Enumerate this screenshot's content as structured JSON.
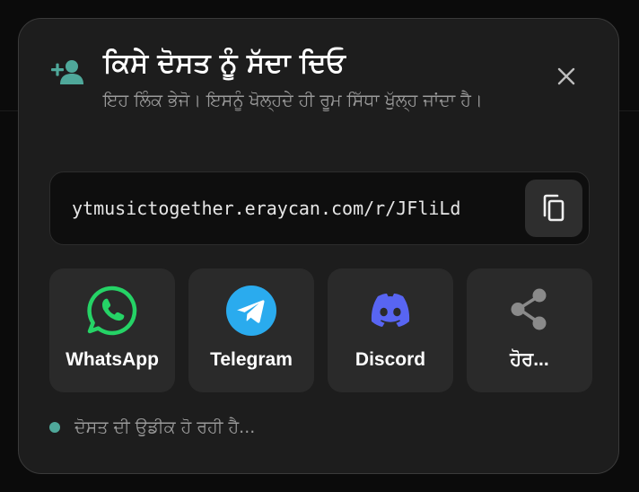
{
  "dialog": {
    "title": "ਕਿਸੇ ਦੋਸਤ ਨੂੰ ਸੱਦਾ ਦਿਓ",
    "subtitle": "ਇਹ ਲਿੰਕ ਭੇਜੋ। ਇਸਨੂੰ ਖੋਲ੍ਹਦੇ ਹੀ ਰੂਮ ਸਿੱਧਾ ਖੁੱਲ੍ਹ ਜਾਂਦਾ ਹੈ।",
    "header_icon": "person-add-icon",
    "close_icon": "close-icon"
  },
  "invite": {
    "link": "ytmusictogether.eraycan.com/r/JFliLd",
    "copy_icon": "copy-icon"
  },
  "share_options": [
    {
      "label": "WhatsApp",
      "icon": "whatsapp-icon",
      "color": "#25D366"
    },
    {
      "label": "Telegram",
      "icon": "telegram-icon",
      "color": "#2AABEE"
    },
    {
      "label": "Discord",
      "icon": "discord-icon",
      "color": "#5865F2"
    },
    {
      "label": "ਹੋਰ...",
      "icon": "share-icon",
      "color": "#8a8a8a"
    }
  ],
  "status": {
    "text": "ਦੋਸਤ ਦੀ ਉਡੀਕ ਹੋ ਰਹੀ ਹੈ...",
    "dot_color": "#4fa89a"
  },
  "colors": {
    "accent": "#4fa89a",
    "dialog_bg": "#1d1d1d",
    "tile_bg": "#2a2a2a"
  }
}
